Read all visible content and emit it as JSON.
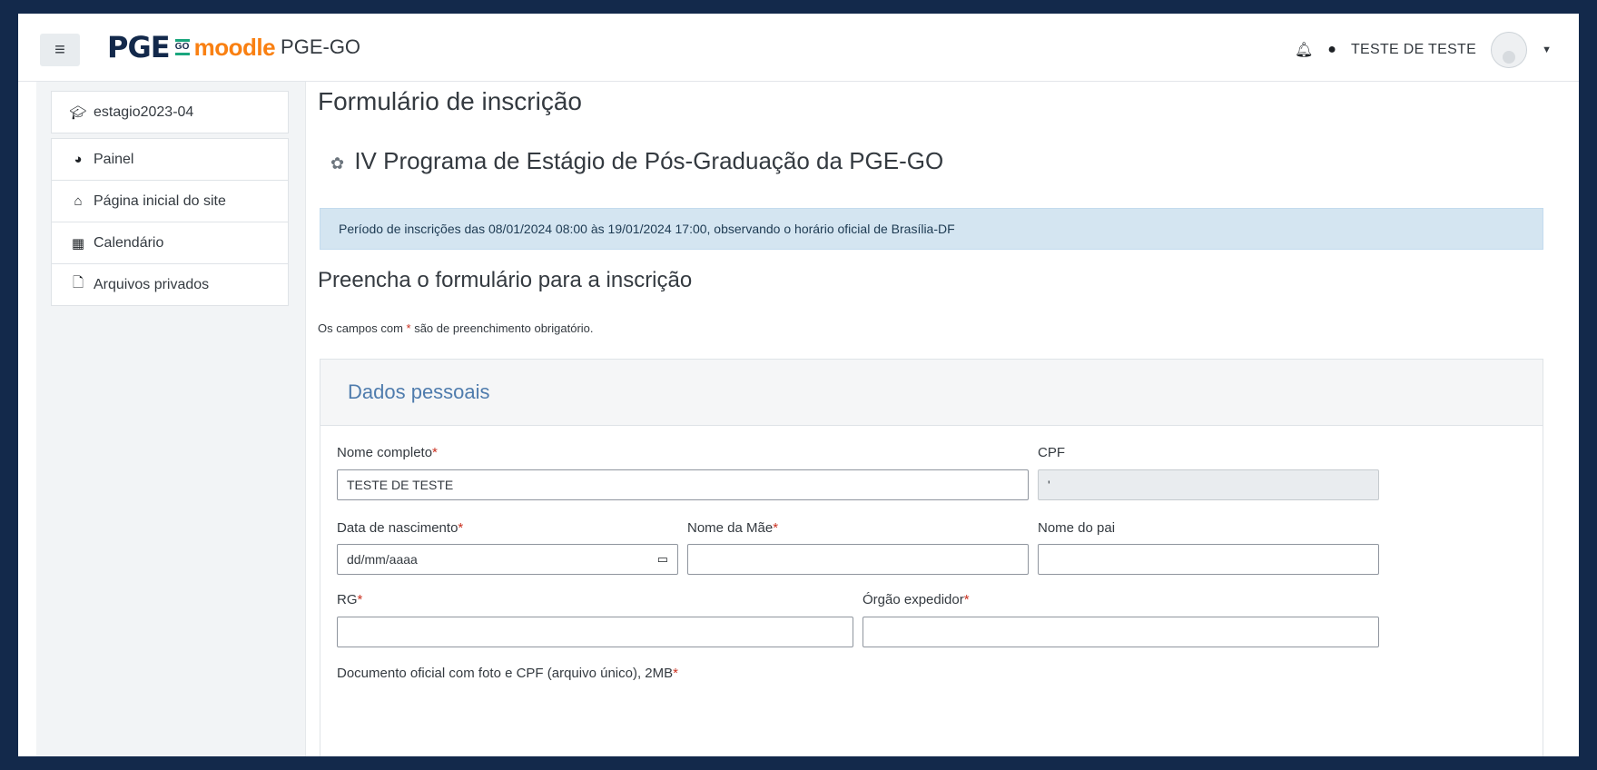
{
  "navbar": {
    "menu_icon": "hamburger-icon",
    "logo_pge": "PGE",
    "logo_go": "GO",
    "logo_moodle": "moodle",
    "site_name": "PGE-GO",
    "notification_icon": "bell-icon",
    "messages_icon": "chat-bubble-icon",
    "user_name": "TESTE DE TESTE",
    "user_menu_caret": "caret-down-icon"
  },
  "sidebar": {
    "course": {
      "label": "estagio2023-04",
      "icon": "graduation-cap-icon"
    },
    "items": [
      {
        "label": "Painel",
        "icon": "dashboard-icon"
      },
      {
        "label": "Página inicial do site",
        "icon": "home-icon"
      },
      {
        "label": "Calendário",
        "icon": "calendar-icon"
      },
      {
        "label": "Arquivos privados",
        "icon": "file-icon"
      }
    ]
  },
  "main": {
    "page_title": "Formulário de inscrição",
    "course_title": "IV Programa de Estágio de Pós-Graduação da PGE-GO",
    "alert": "Período de inscrições das 08/01/2024 08:00 às 19/01/2024 17:00, observando o horário oficial de Brasília-DF",
    "form_heading": "Preencha o formulário para a inscrição",
    "required_note_prefix": "Os campos com ",
    "required_note_star": "*",
    "required_note_suffix": " são de preenchimento obrigatório."
  },
  "form": {
    "section_title": "Dados pessoais",
    "fields": {
      "nome_completo": {
        "label": "Nome completo",
        "required": "*",
        "value": "TESTE DE TESTE"
      },
      "cpf": {
        "label": "CPF",
        "value": "'"
      },
      "data_nascimento": {
        "label": "Data de nascimento",
        "required": "*",
        "placeholder": "dd/mm/aaaa"
      },
      "nome_mae": {
        "label": "Nome da Mãe",
        "required": "*",
        "value": ""
      },
      "nome_pai": {
        "label": "Nome do pai",
        "value": ""
      },
      "rg": {
        "label": "RG",
        "required": "*",
        "value": ""
      },
      "orgao_expedidor": {
        "label": "Órgão expedidor",
        "required": "*",
        "value": ""
      },
      "documento": {
        "label": "Documento oficial com foto e CPF (arquivo único), 2MB",
        "required": "*"
      }
    }
  }
}
